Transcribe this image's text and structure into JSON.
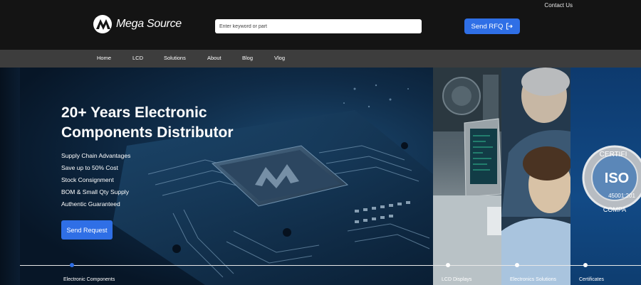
{
  "header": {
    "contact_label": "Contact Us",
    "brand_name": "Mega Source",
    "search_placeholder": "Enter keyword or part",
    "rfq_label": "Send RFQ",
    "rfq_icon": "arrow-right-from-bracket-icon"
  },
  "nav": {
    "items": [
      {
        "label": "Home"
      },
      {
        "label": "LCD"
      },
      {
        "label": "Solutions"
      },
      {
        "label": "About"
      },
      {
        "label": "Blog"
      },
      {
        "label": "Vlog"
      }
    ]
  },
  "hero": {
    "title_line1": "20+ Years Electronic",
    "title_line2": "Components Distributor",
    "features": [
      "Supply Chain Advantages",
      "Save up to 50% Cost",
      "Stock Consignment",
      "BOM & Small Qty Supply",
      "Authentic Guaranteed"
    ],
    "cta_label": "Send Request",
    "cert_badge_text_top": "CERTIFI",
    "cert_badge_text_mid": "ISO",
    "cert_badge_text_code": "45001:201",
    "cert_badge_text_bottom": "COMPA"
  },
  "slides": [
    {
      "label": "Electronic Components",
      "active": true
    },
    {
      "label": "LCD Displays",
      "active": false
    },
    {
      "label": "Electronics Solutions",
      "active": false
    },
    {
      "label": "Certificates",
      "active": false
    }
  ],
  "colors": {
    "accent": "#2f6fe6",
    "header_bg": "#141414",
    "nav_bg": "#3d3d3d"
  }
}
